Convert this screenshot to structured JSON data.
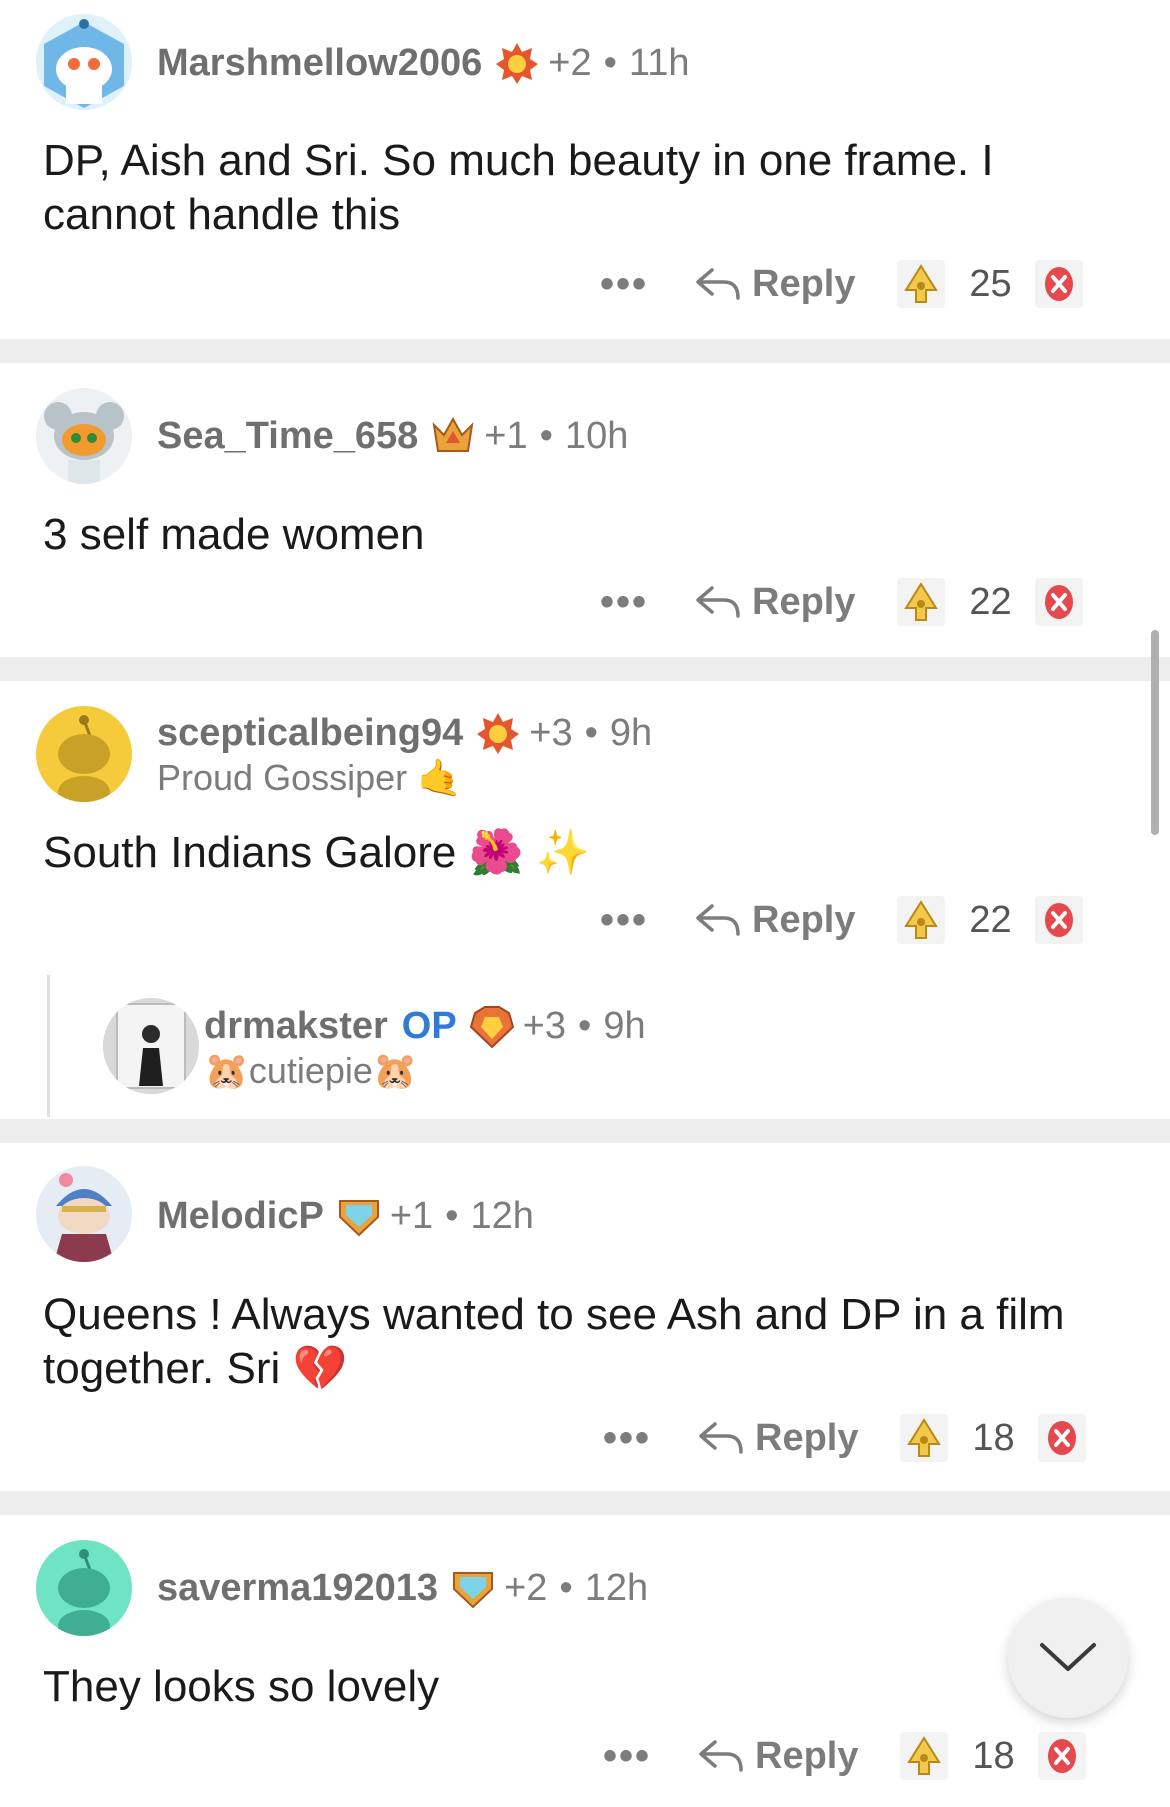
{
  "comments": [
    {
      "user": "Marshmellow2006",
      "karma": "+2",
      "time": "11h",
      "text": "DP, Aish and Sri. So much beauty in one frame. I cannot handle this",
      "reply_label": "Reply",
      "more": "•••",
      "score": "25",
      "avatar_color": "#6fb7e6",
      "flair_icon": "flame-badge-icon"
    },
    {
      "user": "Sea_Time_658",
      "karma": "+1",
      "time": "10h",
      "text": "3 self made women",
      "reply_label": "Reply",
      "more": "•••",
      "score": "22",
      "avatar_color": "#cfd6dc",
      "flair_icon": "crown-badge-icon"
    },
    {
      "user": "scepticalbeing94",
      "karma": "+3",
      "time": "9h",
      "user_flair": "Proud Gossiper 🤙",
      "text": "South Indians Galore 🌺 ✨",
      "reply_label": "Reply",
      "more": "•••",
      "score": "22",
      "avatar_color": "#f5cb3c",
      "flair_icon": "flame-badge-icon"
    },
    {
      "user": "drmakster",
      "op_label": "OP",
      "karma": "+3",
      "time": "9h",
      "user_flair": "🐹cutiepie🐹",
      "avatar_color": "#e8e8e8",
      "flair_icon": "fire-gem-icon"
    },
    {
      "user": "MelodicP",
      "karma": "+1",
      "time": "12h",
      "text": "Queens ! Always wanted to see Ash and DP in a film together. Sri 💔",
      "reply_label": "Reply",
      "more": "•••",
      "score": "18",
      "avatar_color": "#7aa0d6",
      "flair_icon": "diamond-badge-icon"
    },
    {
      "user": "saverma192013",
      "karma": "+2",
      "time": "12h",
      "text": "They looks so lovely",
      "reply_label": "Reply",
      "more": "•••",
      "score": "18",
      "avatar_color": "#6fe4c5",
      "flair_icon": "diamond-badge-icon"
    }
  ],
  "colors": {
    "accent_op": "#2f7bd6",
    "upvote": "#f2c94c",
    "downvote": "#e5484d",
    "divider": "#ededed"
  }
}
